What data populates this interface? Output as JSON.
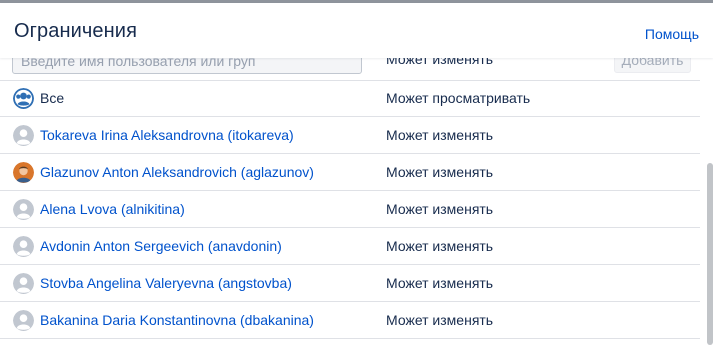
{
  "header": {
    "title": "Ограничения",
    "help_label": "Помощь"
  },
  "add_row": {
    "user_input_placeholder": "Введите имя пользователя или груп",
    "permission_selected": "Может изменять",
    "add_button_label": "Добавить"
  },
  "rows": [
    {
      "name": "Все",
      "permission": "Может просматривать",
      "avatar": "group-avatar-icon"
    },
    {
      "name": "Tokareva Irina Aleksandrovna (itokareva)",
      "permission": "Может изменять",
      "avatar": "default-user-avatar-icon"
    },
    {
      "name": "Glazunov Anton Aleksandrovich (aglazunov)",
      "permission": "Может изменять",
      "avatar": "photo-avatar"
    },
    {
      "name": "Alena Lvova (alnikitina)",
      "permission": "Может изменять",
      "avatar": "default-user-avatar-icon"
    },
    {
      "name": "Avdonin Anton Sergeevich (anavdonin)",
      "permission": "Может изменять",
      "avatar": "default-user-avatar-icon"
    },
    {
      "name": "Stovba Angelina Valeryevna (angstovba)",
      "permission": "Может изменять",
      "avatar": "default-user-avatar-icon"
    },
    {
      "name": "Bakanina Daria Konstantinovna (dbakanina)",
      "permission": "Может изменять",
      "avatar": "default-user-avatar-icon"
    }
  ],
  "colors": {
    "link": "#0052cc",
    "text": "#172b4d",
    "divider": "#dfe1e6",
    "avatar_default": "#c1c7d0"
  }
}
